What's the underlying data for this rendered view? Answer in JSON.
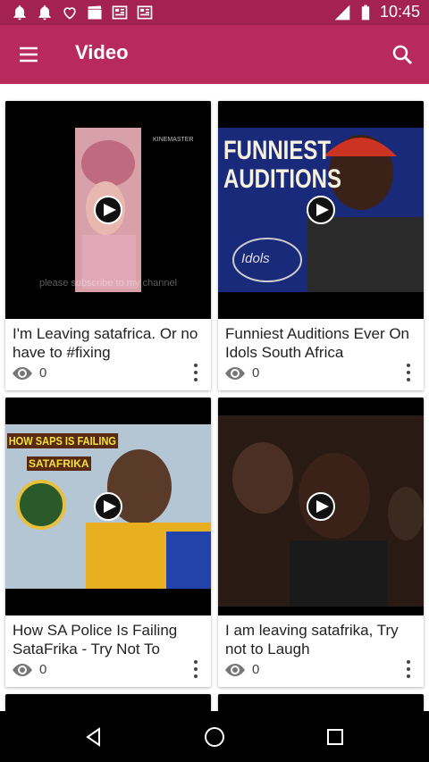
{
  "status_bar": {
    "time": "10:45",
    "network": "LTE"
  },
  "app_bar": {
    "title": "Video"
  },
  "videos": [
    {
      "title": "I'm Leaving satafrica. Or no have to #fixing",
      "views": "0",
      "overlay_caption": "please subscribe to my channel",
      "watermark": "KINEMASTER"
    },
    {
      "title": "Funniest Auditions Ever On Idols South Africa",
      "views": "0",
      "overlay_text": "FUNNIEST AUDITIONS",
      "overlay_logo": "Idols"
    },
    {
      "title": "How SA Police Is Failing SataFrika - Try Not To Laugh",
      "views": "0",
      "overlay_text": "HOW SAPS IS FAILING",
      "overlay_subtext": "SATAFRIKA"
    },
    {
      "title": "I am leaving satafrika, Try not to Laugh",
      "views": "0"
    }
  ],
  "icons": {
    "menu": "menu-icon",
    "search": "search-icon",
    "play": "play-icon",
    "views": "eye-icon",
    "more": "more-vert-icon",
    "nav_back": "back-icon",
    "nav_home": "home-icon",
    "nav_recents": "recents-icon"
  },
  "colors": {
    "app_bar": "#b72a5b",
    "status_bar": "#a3224f",
    "nav_bar": "#000000"
  }
}
